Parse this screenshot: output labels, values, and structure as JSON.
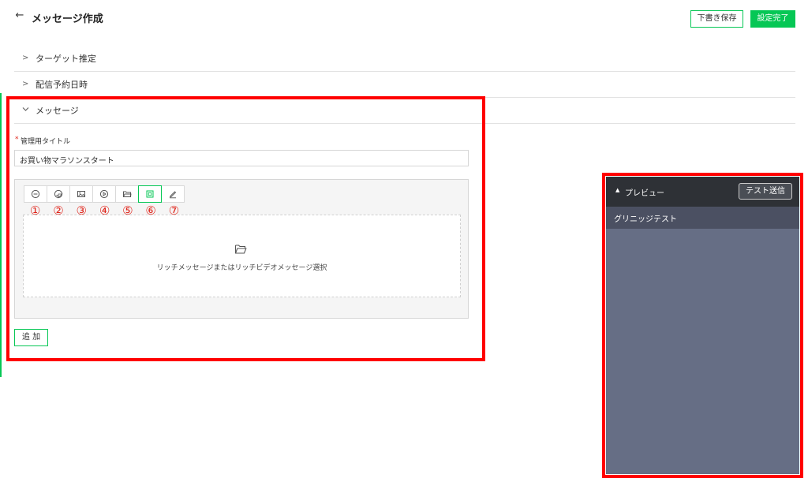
{
  "header": {
    "back_icon": "arrow-left-icon",
    "title": "メッセージ作成",
    "draft_label": "下書き保存",
    "done_label": "設定完了"
  },
  "accordion": [
    {
      "label": "ターゲット推定",
      "icon": "chevron-right-icon"
    },
    {
      "label": "配信予約日時",
      "icon": "chevron-right-icon"
    },
    {
      "label": "メッセージ",
      "icon": "chevron-down-icon"
    }
  ],
  "message": {
    "required_mark": "*",
    "title_label": "管理用タイトル",
    "title_value": "お買い物マラソンスタート",
    "toolbar_icons": [
      "text-icon",
      "sticker-icon",
      "image-icon",
      "video-icon",
      "folder-icon",
      "rich-message-icon",
      "pencil-icon"
    ],
    "annotations": [
      "①",
      "②",
      "③",
      "④",
      "⑤",
      "⑥",
      "⑦"
    ],
    "dropzone_icon": "folder-open-icon",
    "dropzone_text": "リッチメッセージまたはリッチビデオメッセージ選択",
    "add_label": "追 加"
  },
  "preview": {
    "title": "プレビュー",
    "test_label": "テスト送信",
    "user_name": "グリニッジテスト"
  },
  "colors": {
    "accent": "#06c755",
    "highlight": "#ff0000",
    "preview_bg": "#666e85",
    "preview_header": "#2e3136"
  }
}
